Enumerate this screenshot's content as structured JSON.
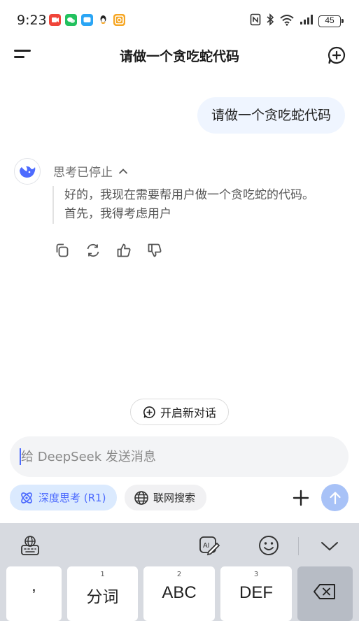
{
  "status_bar": {
    "time": "9:23",
    "battery": "45",
    "app_icons": [
      {
        "name": "video-app-icon",
        "color": "#f0453a"
      },
      {
        "name": "wechat-icon",
        "color": "#22c15e"
      },
      {
        "name": "messages-icon",
        "color": "#2aa5f5"
      },
      {
        "name": "qq-icon",
        "color": "#222222"
      },
      {
        "name": "taobao-icon",
        "color": "#f6a623"
      }
    ],
    "system_icons": [
      "nfc-icon",
      "bluetooth-icon",
      "wifi-icon",
      "signal-icon",
      "battery-icon"
    ]
  },
  "header": {
    "title": "请做一个贪吃蛇代码",
    "menu_icon": "menu-icon",
    "new_chat_icon": "new-chat-icon"
  },
  "conversation": {
    "user_message": "请做一个贪吃蛇代码",
    "assistant": {
      "avatar_icon": "deepseek-whale-icon",
      "thinking_status": "思考已停止",
      "thinking_text_line1": "好的，我现在需要帮用户做一个贪吃蛇的代码。",
      "thinking_text_line2": "首先，我得考虑用户",
      "actions": [
        "copy-icon",
        "regenerate-icon",
        "thumbs-up-icon",
        "thumbs-down-icon"
      ]
    }
  },
  "new_conversation_label": "开启新对话",
  "composer": {
    "placeholder": "给 DeepSeek 发送消息",
    "deep_think_label": "深度思考 (R1)",
    "web_search_label": "联网搜索",
    "accent_color": "#4d6bfe"
  },
  "keyboard": {
    "keys": [
      {
        "num": "",
        "label": ","
      },
      {
        "num": "1",
        "label": "分词"
      },
      {
        "num": "2",
        "label": "ABC"
      },
      {
        "num": "3",
        "label": "DEF"
      }
    ]
  }
}
